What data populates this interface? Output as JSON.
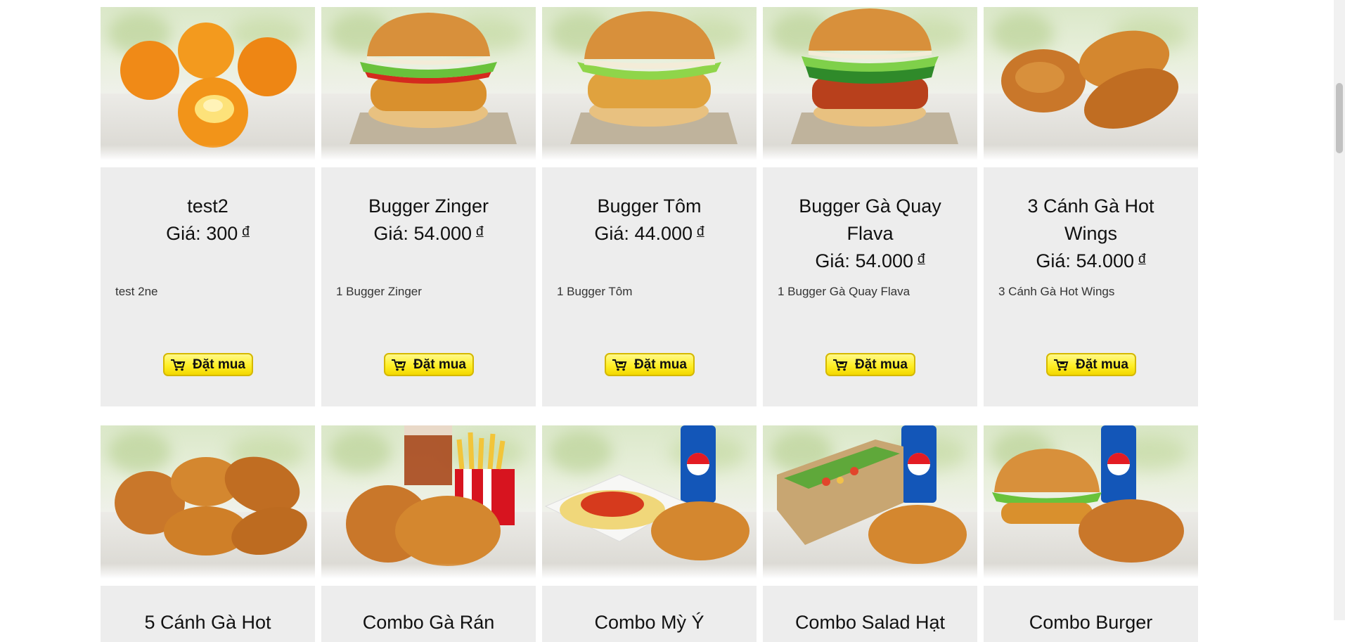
{
  "buy_label": "Đặt mua",
  "price_prefix": "Giá:",
  "currency_symbol": "đ",
  "products_row1": [
    {
      "name": "test2",
      "price": "300",
      "description": "test 2ne",
      "icon": "cheese-balls-photo"
    },
    {
      "name": "Bugger Zinger",
      "price": "54.000",
      "description": "1 Bugger Zinger",
      "icon": "zinger-burger-photo"
    },
    {
      "name": "Bugger Tôm",
      "price": "44.000",
      "description": "1 Bugger Tôm",
      "icon": "shrimp-burger-photo"
    },
    {
      "name": "Bugger Gà Quay Flava",
      "price": "54.000",
      "description": "1 Bugger Gà Quay Flava",
      "icon": "flava-burger-photo"
    },
    {
      "name": "3 Cánh Gà Hot Wings",
      "price": "54.000",
      "description": "3 Cánh Gà Hot Wings",
      "icon": "hot-wings-photo"
    }
  ],
  "products_row2": [
    {
      "name": "5 Cánh Gà Hot",
      "icon": "hot-wings-5-photo"
    },
    {
      "name": "Combo Gà Rán",
      "icon": "fried-chicken-combo-photo"
    },
    {
      "name": "Combo Mỳ Ý",
      "icon": "spaghetti-combo-photo"
    },
    {
      "name": "Combo Salad Hạt",
      "icon": "salad-combo-photo"
    },
    {
      "name": "Combo Burger",
      "icon": "burger-combo-photo"
    }
  ],
  "colors": {
    "card_bg": "#ededed",
    "buy_button": "#ffef26",
    "buy_border": "#d5b800"
  }
}
